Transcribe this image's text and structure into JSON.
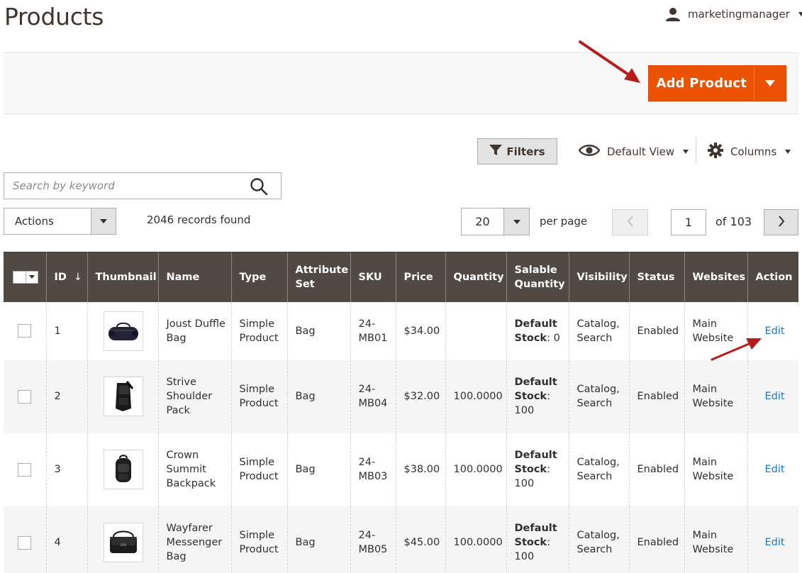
{
  "page": {
    "title": "Products"
  },
  "user": {
    "name": "marketingmanager"
  },
  "toolbar": {
    "add_product_label": "Add Product"
  },
  "controls": {
    "filters_label": "Filters",
    "view_label": "Default View",
    "columns_label": "Columns",
    "search_placeholder": "Search by keyword",
    "actions_label": "Actions",
    "records_found": "2046 records found",
    "per_page_value": "20",
    "per_page_label": "per page",
    "current_page": "1",
    "of_pages": "of 103"
  },
  "grid": {
    "headers": {
      "id": "ID",
      "sort_indicator": "↓",
      "thumbnail": "Thumbnail",
      "name": "Name",
      "type": "Type",
      "attribute_set_l1": "Attribute",
      "attribute_set_l2": "Set",
      "sku": "SKU",
      "price": "Price",
      "quantity": "Quantity",
      "salable_l1": "Salable",
      "salable_l2": "Quantity",
      "visibility": "Visibility",
      "status": "Status",
      "websites": "Websites",
      "action": "Action"
    },
    "rows": [
      {
        "id": "1",
        "name_lines": [
          "Joust Duffle",
          "Bag"
        ],
        "type_lines": [
          "Simple",
          "Product"
        ],
        "attribute_set": "Bag",
        "sku_lines": [
          "24-",
          "MB01"
        ],
        "price": "$34.00",
        "quantity": "",
        "stock_bold_1": "Default",
        "stock_bold_2": "Stock",
        "stock_value": ": 0",
        "stock_layout": "inline",
        "visibility_lines": [
          "Catalog,",
          "Search"
        ],
        "status": "Enabled",
        "website_lines": [
          "Main",
          "Website"
        ],
        "action": "Edit",
        "thumb_icon": "duffle-bag-icon"
      },
      {
        "id": "2",
        "name_lines": [
          "Strive",
          "Shoulder",
          "Pack"
        ],
        "type_lines": [
          "Simple",
          "Product"
        ],
        "attribute_set": "Bag",
        "sku_lines": [
          "24-",
          "MB04"
        ],
        "price": "$32.00",
        "quantity": "100.0000",
        "stock_bold_1": "Default",
        "stock_bold_2": "Stock",
        "stock_value": "100",
        "stock_layout": "block",
        "visibility_lines": [
          "Catalog,",
          "Search"
        ],
        "status": "Enabled",
        "website_lines": [
          "Main",
          "Website"
        ],
        "action": "Edit",
        "thumb_icon": "shoulder-pack-icon"
      },
      {
        "id": "3",
        "name_lines": [
          "Crown",
          "Summit",
          "Backpack"
        ],
        "type_lines": [
          "Simple",
          "Product"
        ],
        "attribute_set": "Bag",
        "sku_lines": [
          "24-",
          "MB03"
        ],
        "price": "$38.00",
        "quantity": "100.0000",
        "stock_bold_1": "Default",
        "stock_bold_2": "Stock",
        "stock_value": "100",
        "stock_layout": "block",
        "visibility_lines": [
          "Catalog,",
          "Search"
        ],
        "status": "Enabled",
        "website_lines": [
          "Main",
          "Website"
        ],
        "action": "Edit",
        "thumb_icon": "backpack-icon"
      },
      {
        "id": "4",
        "name_lines": [
          "Wayfarer",
          "Messenger",
          "Bag"
        ],
        "type_lines": [
          "Simple",
          "Product"
        ],
        "attribute_set": "Bag",
        "sku_lines": [
          "24-",
          "MB05"
        ],
        "price": "$45.00",
        "quantity": "100.0000",
        "stock_bold_1": "Default",
        "stock_bold_2": "Stock",
        "stock_value": "100",
        "stock_layout": "block",
        "visibility_lines": [
          "Catalog,",
          "Search"
        ],
        "status": "Enabled",
        "website_lines": [
          "Main",
          "Website"
        ],
        "action": "Edit",
        "thumb_icon": "messenger-bag-icon"
      }
    ]
  },
  "colors": {
    "accent": "#eb5202",
    "header_bg": "#514943",
    "link": "#1979c3",
    "annotation_arrow": "#b71c1c"
  }
}
